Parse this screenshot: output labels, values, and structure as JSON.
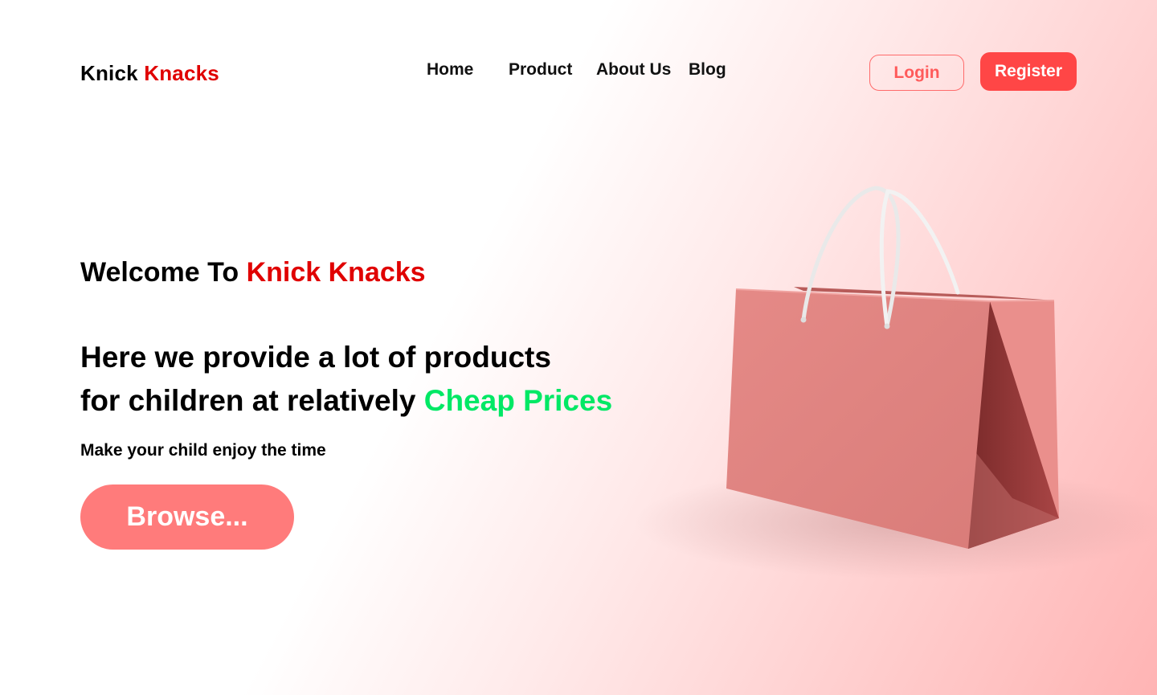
{
  "brand": {
    "name_part1": "Knick",
    "name_part2": "Knacks"
  },
  "nav": {
    "items": [
      {
        "label": "Home"
      },
      {
        "label": "Product"
      },
      {
        "label": "About Us"
      },
      {
        "label": "Blog"
      }
    ]
  },
  "auth": {
    "login_label": "Login",
    "register_label": "Register"
  },
  "hero": {
    "welcome_prefix": "Welcome To",
    "welcome_brand": "Knick Knacks",
    "headline_line1": "Here we provide a lot of products",
    "headline_line2": "for children at relatively",
    "headline_highlight": "Cheap Prices",
    "subtext": "Make your child enjoy the time",
    "browse_label": "Browse..."
  },
  "hero_image": {
    "icon": "shopping-bag-icon"
  },
  "colors": {
    "brand_red": "#e00000",
    "register_bg": "#ff4646",
    "login_border": "#ff6b6b",
    "browse_bg": "#ff7b7b",
    "highlight_green": "#00e865",
    "bag_pink": "#e0827f"
  }
}
